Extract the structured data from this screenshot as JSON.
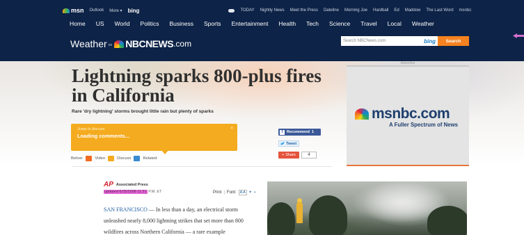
{
  "msnbar": {
    "brand": "msn",
    "links": [
      "Outlook",
      "More ▾"
    ],
    "bing": "bing",
    "shows": [
      "TODAY",
      "Nightly News",
      "Meet the Press",
      "Dateline",
      "Morning Joe",
      "Hardball",
      "Ed",
      "Maddow",
      "The Last Word",
      "msnbc"
    ]
  },
  "nav": [
    "Home",
    "US",
    "World",
    "Politics",
    "Business",
    "Sports",
    "Entertainment",
    "Health",
    "Tech",
    "Science",
    "Travel",
    "Local",
    "Weather"
  ],
  "logo": {
    "section": "Weather",
    "on": "on",
    "nbc": "NBCNEWS",
    "com": ".com"
  },
  "search": {
    "placeholder": "Search NBCNews.com",
    "bing": "bing",
    "button": "Search"
  },
  "article": {
    "headline": "Lightning sparks 800-plus fires in California",
    "deck": "Rare 'dry lightning' storms brought little rain but plenty of sparks",
    "comments_jump": "Jump to discuss",
    "comments_loading": "Loading comments...",
    "comments_close": "×",
    "below_label": "Below:",
    "below_links": [
      "Video",
      "Discuss",
      "Related"
    ],
    "source_name": "Associated Press",
    "source_logo": "AP",
    "updated": "updated 6/25/2008 11:51",
    "updated_rest": "P.M. ET",
    "print": "Print",
    "font": "Font:",
    "font_aa": "A A",
    "plus": "+",
    "minus": "−",
    "dateline": "SAN FRANCISCO",
    "body": " — In less than a day, an electrical storm unleashed nearly 8,000 lightning strikes that set more than 800 wildfires across Northern California — a rare example"
  },
  "social": {
    "recommend": "Recommend",
    "recommend_count": "1",
    "tweet": "Tweet",
    "share": "Share",
    "share_count": "4"
  },
  "ad": {
    "label": "Advertise",
    "brand": "msnbc.com",
    "tagline": "A Fuller Spectrum of News"
  }
}
